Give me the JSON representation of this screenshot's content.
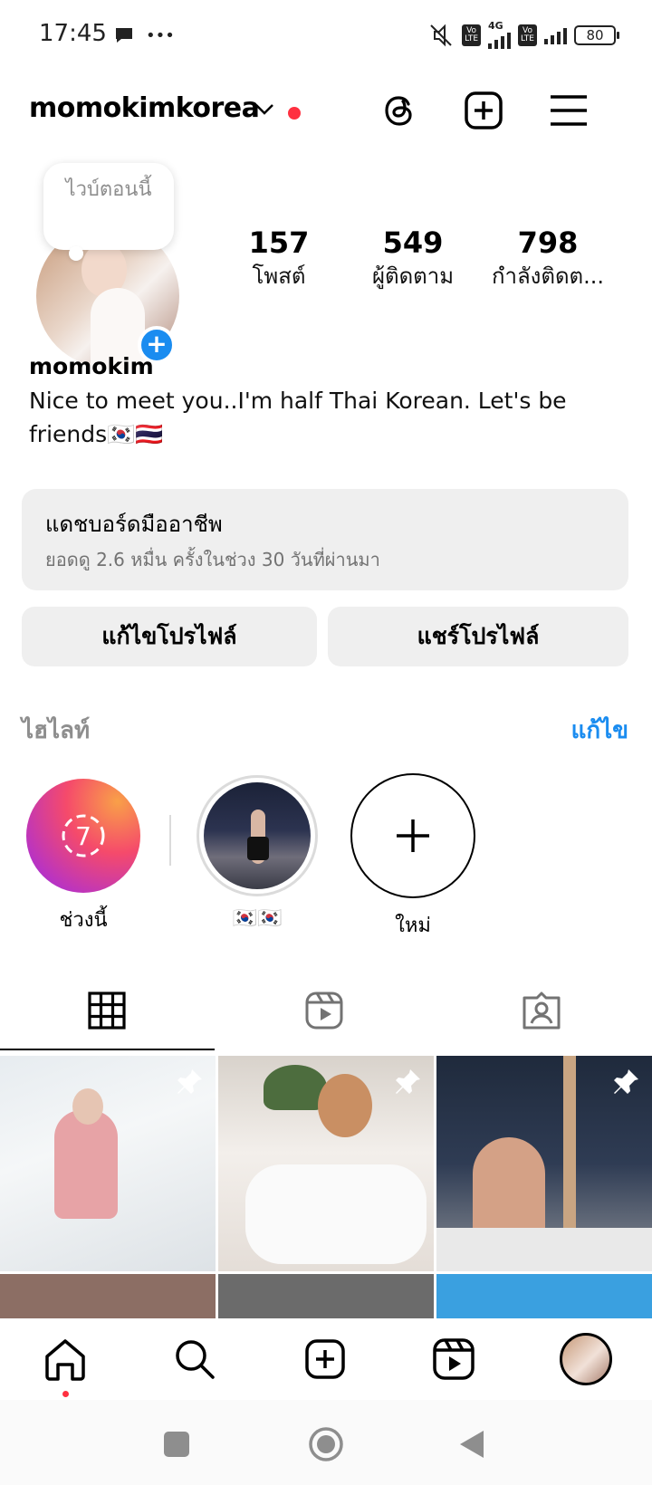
{
  "status_bar": {
    "time": "17:45",
    "extra": "•••",
    "battery": "80",
    "network": "4G",
    "volte_1": "Vo\nLTE",
    "volte_2": "Vo\nLTE"
  },
  "header": {
    "username": "momokimkorea"
  },
  "profile": {
    "note": "ไวบ์ตอนนี้",
    "stats": [
      {
        "value": "157",
        "label": "โพสต์"
      },
      {
        "value": "549",
        "label": "ผู้ติดตาม"
      },
      {
        "value": "798",
        "label": "กำลังติดต..."
      }
    ],
    "display_name": "momokim",
    "bio": "Nice to meet you..I'm half Thai  Korean. Let's be friends🇰🇷🇹🇭"
  },
  "dashboard": {
    "title": "แดชบอร์ดมืออาชีพ",
    "subtitle": "ยอดดู 2.6 หมื่น ครั้งในช่วง 30 วันที่ผ่านมา"
  },
  "buttons": {
    "edit_profile": "แก้ไขโปรไฟล์",
    "share_profile": "แชร์โปรไฟล์"
  },
  "highlights": {
    "heading": "ไฮไลท์",
    "edit": "แก้ไข",
    "items": [
      {
        "label": "ช่วงนี้",
        "badge": "7"
      },
      {
        "label": "🇰🇷🇰🇷"
      },
      {
        "label": "ใหม่"
      }
    ]
  },
  "colors": {
    "accent": "#1a8cf0",
    "notification": "#ff3040",
    "button_bg": "#efefef"
  },
  "icons": {
    "threads": "threads-icon",
    "create": "plus-square-icon",
    "menu": "hamburger-menu-icon",
    "grid_tab": "grid-icon",
    "reels_tab": "reels-icon",
    "tagged_tab": "tagged-icon",
    "nav_home": "home-icon",
    "nav_search": "search-icon",
    "nav_create": "plus-square-icon",
    "nav_reels": "reels-icon",
    "nav_profile": "avatar",
    "pin": "pin-icon"
  }
}
